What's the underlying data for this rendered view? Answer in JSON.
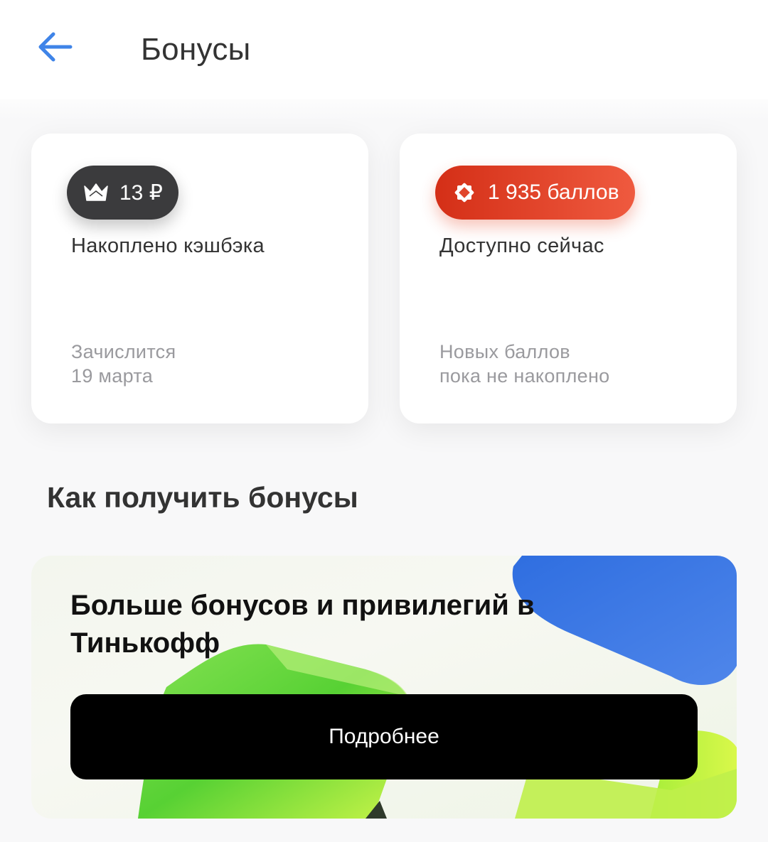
{
  "header": {
    "title": "Бонусы",
    "back_icon": "arrow-left-icon",
    "accent_color": "#3f84e8"
  },
  "cards": {
    "cashback": {
      "amount": "13 ₽",
      "icon": "crown-icon",
      "label": "Накоплено кэшбэка",
      "sub_line1": "Зачислится",
      "sub_line2": "19 марта",
      "pill_color": "#3b3b3d"
    },
    "points": {
      "amount": "1 935 баллов",
      "icon": "star-badge-icon",
      "label": "Доступно сейчас",
      "sub_line1": "Новых баллов",
      "sub_line2": "пока не накоплено",
      "pill_color": "#e0452b"
    }
  },
  "section": {
    "title": "Как получить бонусы"
  },
  "promo": {
    "title": "Больше бонусов и привилегий в Тинькофф",
    "button_label": "Подробнее"
  }
}
